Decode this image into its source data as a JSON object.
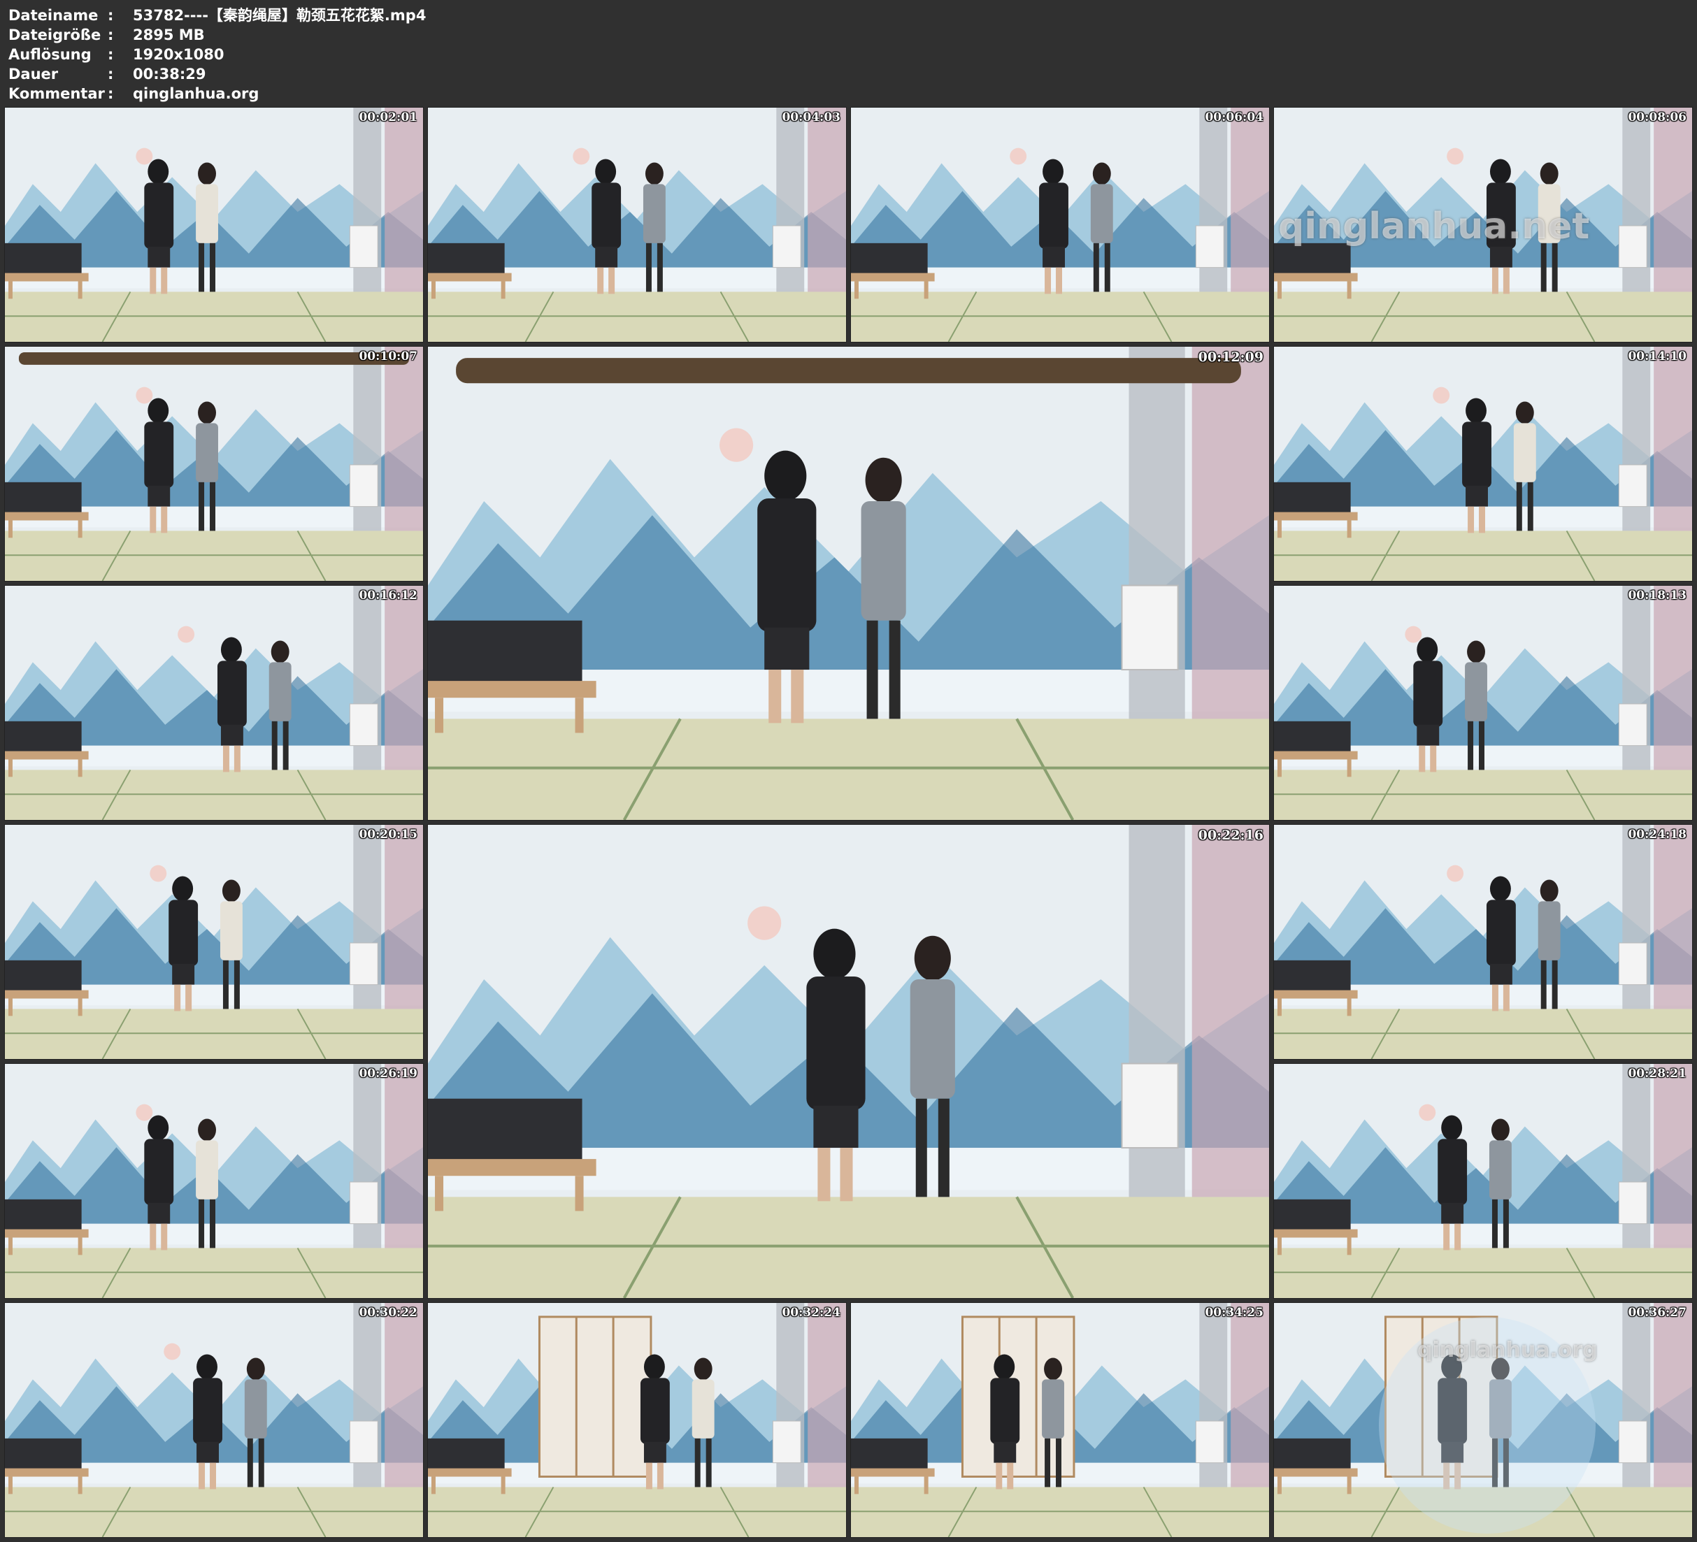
{
  "info": [
    {
      "label": "Dateiname",
      "sep": ":",
      "value": "53782----【秦韵绳屋】勒颈五花花絮.mp4"
    },
    {
      "label": "Dateigröße",
      "sep": ":",
      "value": "2895 MB"
    },
    {
      "label": "Auflösung",
      "sep": ":",
      "value": "1920x1080"
    },
    {
      "label": "Dauer",
      "sep": ":",
      "value": "00:38:29"
    },
    {
      "label": "Kommentar",
      "sep": ":",
      "value": "qinglanhua.org"
    }
  ],
  "thumbnails": [
    {
      "time": "00:02:01"
    },
    {
      "time": "00:04:03"
    },
    {
      "time": "00:06:04"
    },
    {
      "time": "00:08:06"
    },
    {
      "time": "00:10:07"
    },
    {
      "time": "00:12:09"
    },
    {
      "time": "00:14:10"
    },
    {
      "time": "00:16:12"
    },
    {
      "time": "00:18:13"
    },
    {
      "time": "00:20:15"
    },
    {
      "time": "00:22:16"
    },
    {
      "time": "00:24:18"
    },
    {
      "time": "00:26:19"
    },
    {
      "time": "00:28:21"
    },
    {
      "time": "00:30:22"
    },
    {
      "time": "00:32:24"
    },
    {
      "time": "00:34:25"
    },
    {
      "time": "00:36:27"
    }
  ],
  "watermarks": {
    "thumb4": "qinglanhua.net",
    "thumb18": "qinglanhua.org"
  },
  "colors": {
    "background": "#303030",
    "wall": "#e8eef2",
    "mountain_dark": "#2f6f9a",
    "mountain_light": "#8fbfd8",
    "floor": "#d9d9b8"
  }
}
